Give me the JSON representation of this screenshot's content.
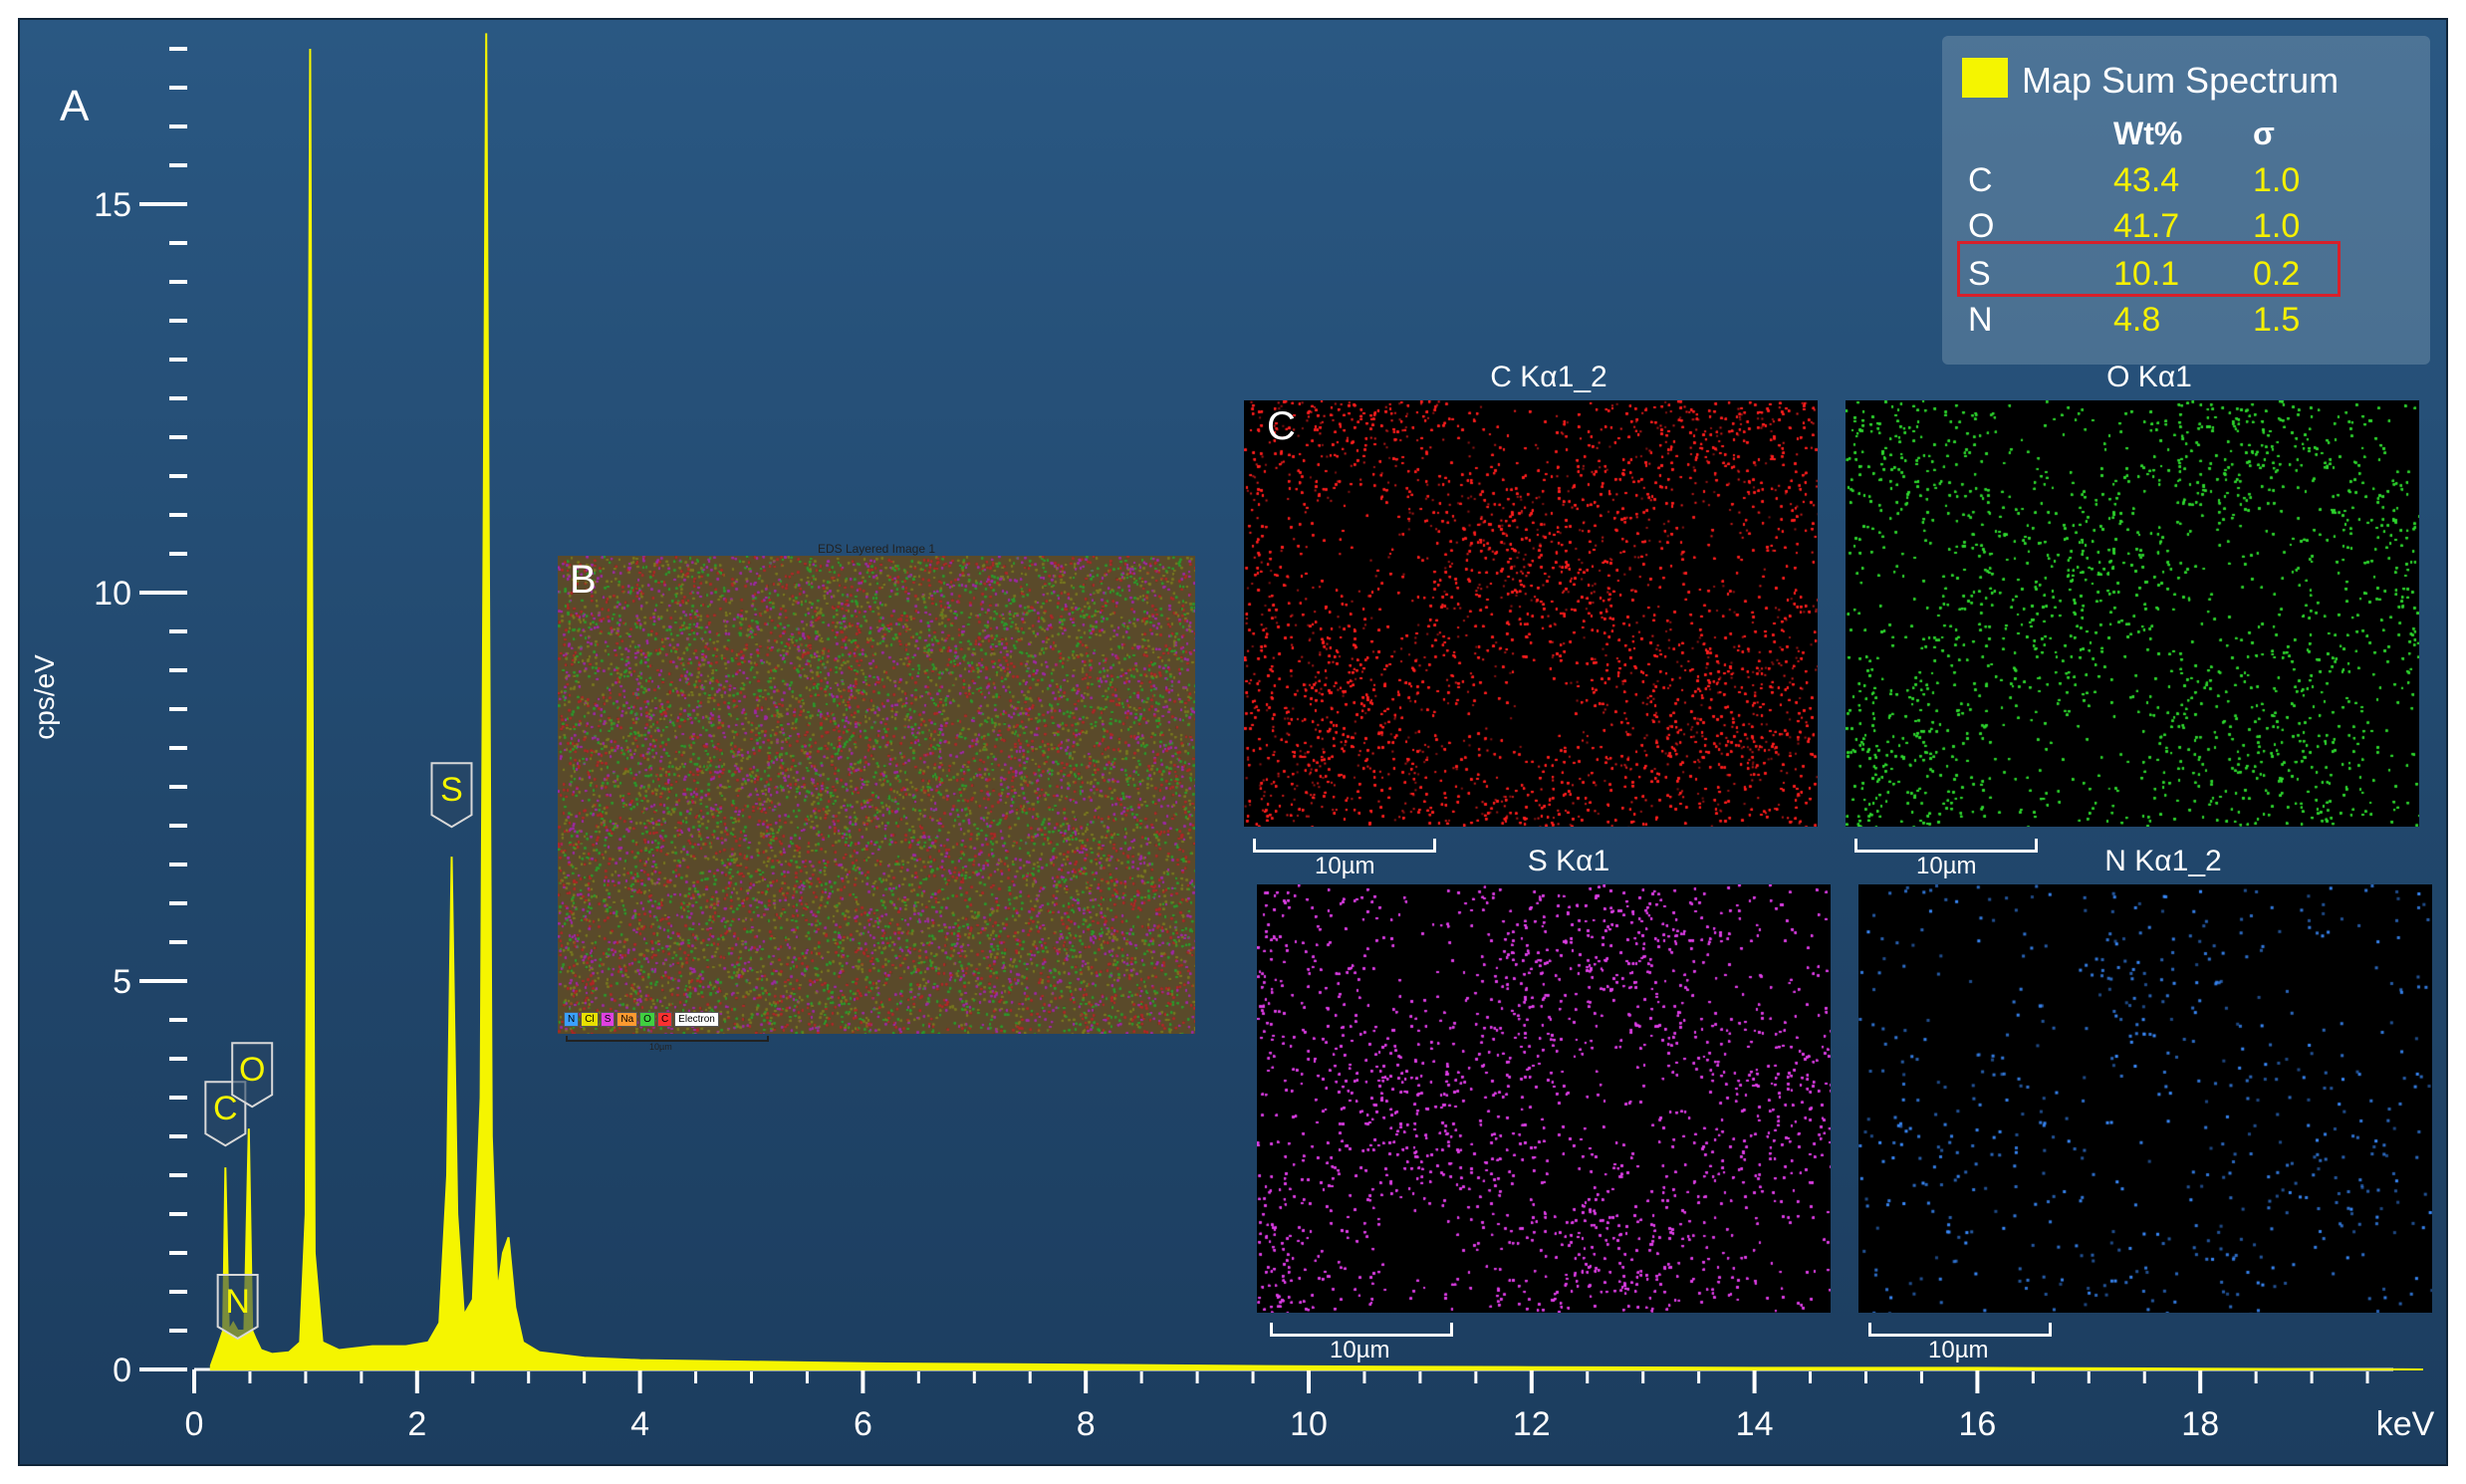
{
  "chart_data": {
    "type": "line",
    "title": "",
    "xlabel": "keV",
    "ylabel": "cps/eV",
    "xlim": [
      0,
      20
    ],
    "ylim": [
      0,
      17
    ],
    "x_ticks": [
      "0",
      "2",
      "4",
      "6",
      "8",
      "10",
      "12",
      "14",
      "16",
      "18"
    ],
    "y_ticks": [
      "0",
      "5",
      "10",
      "15"
    ],
    "series": [
      {
        "name": "Map Sum Spectrum",
        "color": "#f5f500",
        "x": [
          0.15,
          0.2,
          0.26,
          0.28,
          0.31,
          0.35,
          0.39,
          0.45,
          0.49,
          0.52,
          0.55,
          0.6,
          0.7,
          0.85,
          0.95,
          1.0,
          1.04,
          1.08,
          1.15,
          1.3,
          1.6,
          1.9,
          2.1,
          2.2,
          2.27,
          2.31,
          2.36,
          2.42,
          2.5,
          2.57,
          2.62,
          2.67,
          2.72,
          2.77,
          2.82,
          2.88,
          2.95,
          3.1,
          3.5,
          4.0,
          5.0,
          6.0,
          8.0,
          10.0,
          12.0,
          14.0,
          16.0,
          18.0,
          20.0
        ],
        "y": [
          0.05,
          0.25,
          0.5,
          2.6,
          0.5,
          0.6,
          0.5,
          0.5,
          3.1,
          0.5,
          0.4,
          0.25,
          0.2,
          0.22,
          0.35,
          2.0,
          17.0,
          1.5,
          0.35,
          0.25,
          0.3,
          0.3,
          0.35,
          0.6,
          2.5,
          6.6,
          2.0,
          0.7,
          0.9,
          3.5,
          17.2,
          3.0,
          1.0,
          1.5,
          1.7,
          0.8,
          0.35,
          0.22,
          0.15,
          0.12,
          0.1,
          0.08,
          0.06,
          0.04,
          0.03,
          0.02,
          0.02,
          0.01,
          0.0
        ]
      }
    ],
    "peak_labels": [
      {
        "label": "C",
        "x": 0.28,
        "y": 2.6
      },
      {
        "label": "N",
        "x": 0.39,
        "y": 0.5
      },
      {
        "label": "O",
        "x": 0.52,
        "y": 3.1
      },
      {
        "label": "S",
        "x": 2.31,
        "y": 6.6
      }
    ],
    "table": {
      "title": "Map Sum Spectrum",
      "columns": [
        "",
        "Wt%",
        "σ"
      ],
      "rows": [
        {
          "element": "C",
          "wt": "43.4",
          "sigma": "1.0"
        },
        {
          "element": "O",
          "wt": "41.7",
          "sigma": "1.0"
        },
        {
          "element": "S",
          "wt": "10.1",
          "sigma": "0.2"
        },
        {
          "element": "N",
          "wt": "4.8",
          "sigma": "1.5"
        }
      ],
      "highlighted_row": "S"
    }
  },
  "panels": {
    "a": "A",
    "b": "B",
    "c": "C"
  },
  "layered": {
    "title": "EDS Layered Image 1",
    "legend": [
      "N",
      "Cl",
      "S",
      "Na",
      "O",
      "C",
      "Electron"
    ],
    "legend_colors": [
      "#3aa0ff",
      "#e8e000",
      "#e040e0",
      "#ff9a30",
      "#40d040",
      "#ff3030",
      "#ffffff"
    ],
    "scale": "10µm"
  },
  "maps": [
    {
      "title": "C Kα1_2",
      "scale": "10µm",
      "color": "#ff2020",
      "density": 0.45
    },
    {
      "title": "O Kα1",
      "scale": "10µm",
      "color": "#30d830",
      "density": 0.45
    },
    {
      "title": "S Kα1",
      "scale": "10µm",
      "color": "#e040e8",
      "density": 0.6
    },
    {
      "title": "N Kα1_2",
      "scale": "10µm",
      "color": "#3a8cff",
      "density": 0.015
    }
  ],
  "colors": {
    "spectrum": "#f5f500",
    "highlight": "#d8202a"
  }
}
